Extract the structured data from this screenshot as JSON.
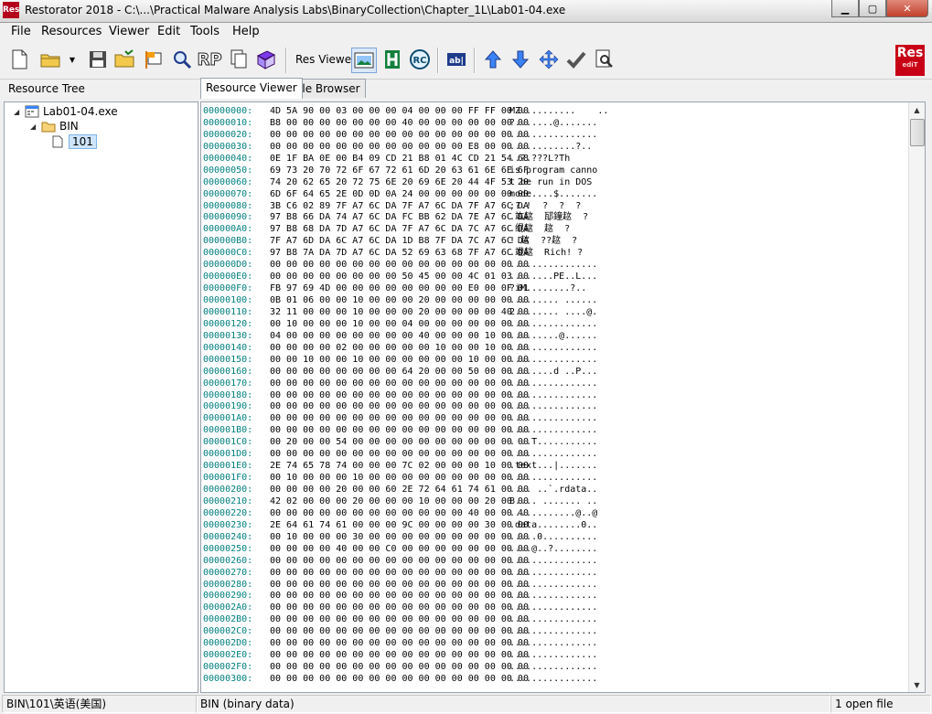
{
  "window": {
    "app_icon_text": "Res",
    "title": "Restorator 2018 - C:\\...\\Practical Malware Analysis Labs\\BinaryCollection\\Chapter_1L\\Lab01-04.exe"
  },
  "menu": [
    "File",
    "Resources",
    "Viewer",
    "Edit",
    "Tools",
    "Help"
  ],
  "toolbar": {
    "res_viewer_label": "Res Viewer:",
    "rp_label": "RP",
    "logo_text": "Res",
    "logo_subtext": "ediT"
  },
  "left_panel": {
    "title": "Resource Tree",
    "tree": {
      "root": "Lab01-04.exe",
      "folder": "BIN",
      "item": "101"
    }
  },
  "tabs": [
    {
      "label": "Resource Viewer",
      "active": true
    },
    {
      "label": "File Browser",
      "active": false
    }
  ],
  "hex_rows": [
    {
      "addr": "00000000:",
      "bytes": "4D 5A 90 00 03 00 00 00 04 00 00 00 FF FF 00 00",
      "ascii": "MZ..........    .."
    },
    {
      "addr": "00000010:",
      "bytes": "B8 00 00 00 00 00 00 00 40 00 00 00 00 00 00 00",
      "ascii": "?.......@......."
    },
    {
      "addr": "00000020:",
      "bytes": "00 00 00 00 00 00 00 00 00 00 00 00 00 00 00 00",
      "ascii": "................"
    },
    {
      "addr": "00000030:",
      "bytes": "00 00 00 00 00 00 00 00 00 00 00 00 E8 00 00 00",
      "ascii": "............?.."
    },
    {
      "addr": "00000040:",
      "bytes": "0E 1F BA 0E 00 B4 09 CD 21 B8 01 4C CD 21 54 68",
      "ascii": "..?.???L?Th"
    },
    {
      "addr": "00000050:",
      "bytes": "69 73 20 70 72 6F 67 72 61 6D 20 63 61 6E 6E 6F",
      "ascii": "is program canno"
    },
    {
      "addr": "00000060:",
      "bytes": "74 20 62 65 20 72 75 6E 20 69 6E 20 44 4F 53 20",
      "ascii": "t be run in DOS "
    },
    {
      "addr": "00000070:",
      "bytes": "6D 6F 64 65 2E 0D 0D 0A 24 00 00 00 00 00 00 00",
      "ascii": "mode....$......."
    },
    {
      "addr": "00000080:",
      "bytes": "3B C6 02 89 7F A7 6C DA 7F A7 6C DA 7F A7 6C DA",
      "ascii": ";?.!  ?  ?  ?"
    },
    {
      "addr": "00000090:",
      "bytes": "97 B8 66 DA 74 A7 6C DA FC BB 62 DA 7E A7 6C DA",
      "ascii": ".竑趑  邷鐘趑  ?"
    },
    {
      "addr": "000000A0:",
      "bytes": "97 B8 68 DA 7D A7 6C DA 7F A7 6C DA 7C A7 6C DA",
      "ascii": ".绲趑  趑  ?"
    },
    {
      "addr": "000000B0:",
      "bytes": "7F A7 6D DA 6C A7 6C DA 1D B8 7F DA 7C A7 6C DA",
      "ascii": "! 趑  ??趑  ?"
    },
    {
      "addr": "000000C0:",
      "bytes": "97 B8 7A DA 7D A7 6C DA 52 69 63 68 7F A7 6C DA",
      "ascii": ".竳趑  Rich! ?"
    },
    {
      "addr": "000000D0:",
      "bytes": "00 00 00 00 00 00 00 00 00 00 00 00 00 00 00 00",
      "ascii": "................"
    },
    {
      "addr": "000000E0:",
      "bytes": "00 00 00 00 00 00 00 00 50 45 00 00 4C 01 03 00",
      "ascii": "........PE..L..."
    },
    {
      "addr": "000000F0:",
      "bytes": "FB 97 69 4D 00 00 00 00 00 00 00 00 E0 00 0F 01",
      "ascii": "?iM........?.."
    },
    {
      "addr": "00000100:",
      "bytes": "0B 01 06 00 00 10 00 00 00 20 00 00 00 00 00 00",
      "ascii": "......... ......"
    },
    {
      "addr": "00000110:",
      "bytes": "32 11 00 00 00 10 00 00 00 20 00 00 00 00 40 00",
      "ascii": "2........ ....@."
    },
    {
      "addr": "00000120:",
      "bytes": "00 10 00 00 00 10 00 00 04 00 00 00 00 00 00 00",
      "ascii": "................"
    },
    {
      "addr": "00000130:",
      "bytes": "04 00 00 00 00 00 00 00 00 40 00 00 00 10 00 00",
      "ascii": ".........@......"
    },
    {
      "addr": "00000140:",
      "bytes": "00 00 00 00 02 00 00 00 00 00 10 00 00 10 00 00",
      "ascii": "................"
    },
    {
      "addr": "00000150:",
      "bytes": "00 00 10 00 00 10 00 00 00 00 00 00 10 00 00 00",
      "ascii": "................"
    },
    {
      "addr": "00000160:",
      "bytes": "00 00 00 00 00 00 00 00 64 20 00 00 50 00 00 00",
      "ascii": "........d ..P..."
    },
    {
      "addr": "00000170:",
      "bytes": "00 00 00 00 00 00 00 00 00 00 00 00 00 00 00 00",
      "ascii": "................"
    },
    {
      "addr": "00000180:",
      "bytes": "00 00 00 00 00 00 00 00 00 00 00 00 00 00 00 00",
      "ascii": "................"
    },
    {
      "addr": "00000190:",
      "bytes": "00 00 00 00 00 00 00 00 00 00 00 00 00 00 00 00",
      "ascii": "................"
    },
    {
      "addr": "000001A0:",
      "bytes": "00 00 00 00 00 00 00 00 00 00 00 00 00 00 00 00",
      "ascii": "................"
    },
    {
      "addr": "000001B0:",
      "bytes": "00 00 00 00 00 00 00 00 00 00 00 00 00 00 00 00",
      "ascii": "................"
    },
    {
      "addr": "000001C0:",
      "bytes": "00 20 00 00 54 00 00 00 00 00 00 00 00 00 00 00",
      "ascii": ". ..T..........."
    },
    {
      "addr": "000001D0:",
      "bytes": "00 00 00 00 00 00 00 00 00 00 00 00 00 00 00 00",
      "ascii": "................"
    },
    {
      "addr": "000001E0:",
      "bytes": "2E 74 65 78 74 00 00 00 7C 02 00 00 00 10 00 00",
      "ascii": ".text...|......."
    },
    {
      "addr": "000001F0:",
      "bytes": "00 10 00 00 00 10 00 00 00 00 00 00 00 00 00 00",
      "ascii": "................"
    },
    {
      "addr": "00000200:",
      "bytes": "00 00 00 00 20 00 00 60 2E 72 64 61 74 61 00 00",
      "ascii": ".... ..`.rdata.."
    },
    {
      "addr": "00000210:",
      "bytes": "42 02 00 00 00 20 00 00 00 10 00 00 00 20 00 00",
      "ascii": "B.... ....... .."
    },
    {
      "addr": "00000220:",
      "bytes": "00 00 00 00 00 00 00 00 00 00 00 00 40 00 00 40",
      "ascii": "............@..@"
    },
    {
      "addr": "00000230:",
      "bytes": "2E 64 61 74 61 00 00 00 9C 00 00 00 00 30 00 00",
      "ascii": ".data........0.."
    },
    {
      "addr": "00000240:",
      "bytes": "00 10 00 00 00 30 00 00 00 00 00 00 00 00 00 00",
      "ascii": ".....0.........."
    },
    {
      "addr": "00000250:",
      "bytes": "00 00 00 00 40 00 00 C0 00 00 00 00 00 00 00 00",
      "ascii": "....@..?........"
    },
    {
      "addr": "00000260:",
      "bytes": "00 00 00 00 00 00 00 00 00 00 00 00 00 00 00 00",
      "ascii": "................"
    },
    {
      "addr": "00000270:",
      "bytes": "00 00 00 00 00 00 00 00 00 00 00 00 00 00 00 00",
      "ascii": "................"
    },
    {
      "addr": "00000280:",
      "bytes": "00 00 00 00 00 00 00 00 00 00 00 00 00 00 00 00",
      "ascii": "................"
    },
    {
      "addr": "00000290:",
      "bytes": "00 00 00 00 00 00 00 00 00 00 00 00 00 00 00 00",
      "ascii": "................"
    },
    {
      "addr": "000002A0:",
      "bytes": "00 00 00 00 00 00 00 00 00 00 00 00 00 00 00 00",
      "ascii": "................"
    },
    {
      "addr": "000002B0:",
      "bytes": "00 00 00 00 00 00 00 00 00 00 00 00 00 00 00 00",
      "ascii": "................"
    },
    {
      "addr": "000002C0:",
      "bytes": "00 00 00 00 00 00 00 00 00 00 00 00 00 00 00 00",
      "ascii": "................"
    },
    {
      "addr": "000002D0:",
      "bytes": "00 00 00 00 00 00 00 00 00 00 00 00 00 00 00 00",
      "ascii": "................"
    },
    {
      "addr": "000002E0:",
      "bytes": "00 00 00 00 00 00 00 00 00 00 00 00 00 00 00 00",
      "ascii": "................"
    },
    {
      "addr": "000002F0:",
      "bytes": "00 00 00 00 00 00 00 00 00 00 00 00 00 00 00 00",
      "ascii": "................"
    },
    {
      "addr": "00000300:",
      "bytes": "00 00 00 00 00 00 00 00 00 00 00 00 00 00 00 00",
      "ascii": "................"
    }
  ],
  "status": {
    "path": "BIN\\101\\英语(美国)",
    "type": "BIN (binary data)",
    "files": "1 open file"
  },
  "colors": {
    "address": "#007f7f",
    "close_button": "#c2402b",
    "logo": "#c80016"
  }
}
